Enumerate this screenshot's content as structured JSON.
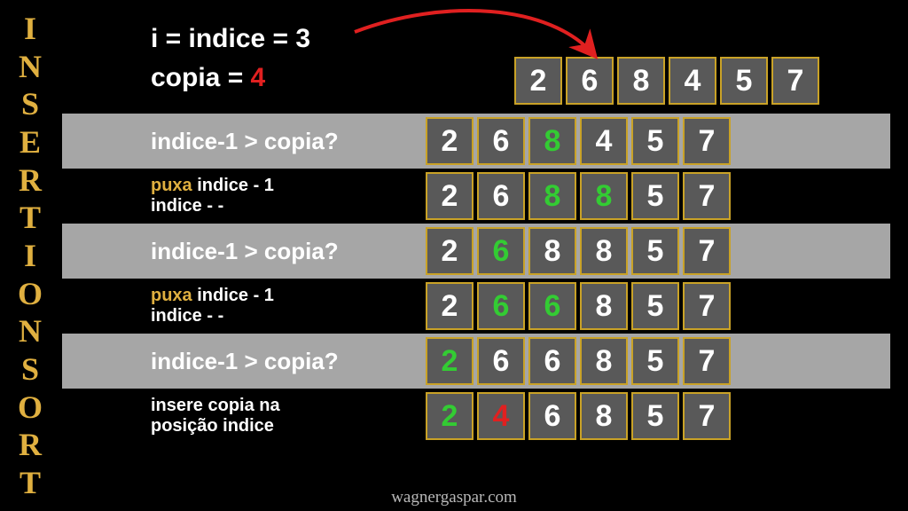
{
  "title_letters": [
    "I",
    "N",
    "S",
    "E",
    "R",
    "T",
    "I",
    "O",
    "N",
    "S",
    "O",
    "R",
    "T"
  ],
  "top": {
    "line1": "i = indice = 3",
    "line2_prefix": "copia = ",
    "line2_value": "4"
  },
  "rows": [
    {
      "bg": "none",
      "kind": "array",
      "label": "",
      "label_small": false,
      "cells": [
        {
          "v": "2"
        },
        {
          "v": "6"
        },
        {
          "v": "8"
        },
        {
          "v": "4"
        },
        {
          "v": "5"
        },
        {
          "v": "7"
        }
      ]
    },
    {
      "bg": "gray",
      "kind": "step",
      "label": "indice-1 > copia?",
      "label_small": false,
      "cells": [
        {
          "v": "2"
        },
        {
          "v": "6"
        },
        {
          "v": "8",
          "c": "green"
        },
        {
          "v": "4"
        },
        {
          "v": "5"
        },
        {
          "v": "7"
        }
      ]
    },
    {
      "bg": "none",
      "kind": "step",
      "label_html": "<span class='y'>puxa</span> indice - 1<br>indice - -",
      "label_small": true,
      "cells": [
        {
          "v": "2"
        },
        {
          "v": "6"
        },
        {
          "v": "8",
          "c": "green"
        },
        {
          "v": "8",
          "c": "green"
        },
        {
          "v": "5"
        },
        {
          "v": "7"
        }
      ]
    },
    {
      "bg": "gray",
      "kind": "step",
      "label": "indice-1 > copia?",
      "label_small": false,
      "cells": [
        {
          "v": "2"
        },
        {
          "v": "6",
          "c": "green"
        },
        {
          "v": "8"
        },
        {
          "v": "8"
        },
        {
          "v": "5"
        },
        {
          "v": "7"
        }
      ]
    },
    {
      "bg": "none",
      "kind": "step",
      "label_html": "<span class='y'>puxa</span> indice - 1<br>indice - -",
      "label_small": true,
      "cells": [
        {
          "v": "2"
        },
        {
          "v": "6",
          "c": "green"
        },
        {
          "v": "6",
          "c": "green"
        },
        {
          "v": "8"
        },
        {
          "v": "5"
        },
        {
          "v": "7"
        }
      ]
    },
    {
      "bg": "gray",
      "kind": "step",
      "label": "indice-1 > copia?",
      "label_small": false,
      "cells": [
        {
          "v": "2",
          "c": "green"
        },
        {
          "v": "6"
        },
        {
          "v": "6"
        },
        {
          "v": "8"
        },
        {
          "v": "5"
        },
        {
          "v": "7"
        }
      ]
    },
    {
      "bg": "none",
      "kind": "step",
      "label_html": "insere copia na<br>posição indice",
      "label_small": true,
      "cells": [
        {
          "v": "2",
          "c": "green"
        },
        {
          "v": "4",
          "c": "red"
        },
        {
          "v": "6"
        },
        {
          "v": "8"
        },
        {
          "v": "5"
        },
        {
          "v": "7"
        }
      ]
    }
  ],
  "footer": "wagnergaspar.com",
  "colors": {
    "accent": "#e0b040",
    "cell_bg": "#595959",
    "cell_border": "#c9a227",
    "green": "#33cc33",
    "red": "#e02020"
  }
}
